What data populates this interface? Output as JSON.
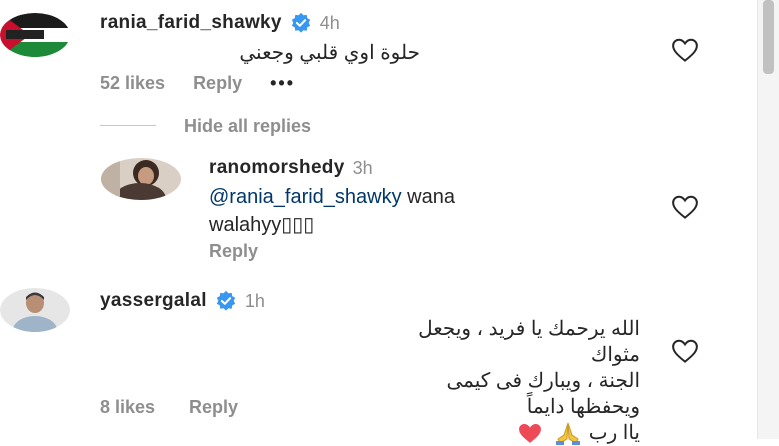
{
  "comments": [
    {
      "username": "rania_farid_shawky",
      "time": "4h",
      "text": "حلوة اوي قلبي وجعني",
      "likes": "52 likes",
      "reply_label": "Reply",
      "more_label": "•••"
    },
    {
      "username": "yassergalal",
      "time": "1h",
      "text_lines": [
        "الله يرحمك يا فريد ، ويجعل مثواك",
        "الجنة ، ويبارك فى كيمى ويحفظها دايماً",
        "ياا رب"
      ],
      "likes": "8 likes",
      "reply_label": "Reply"
    }
  ],
  "hide_replies_label": "Hide all replies",
  "reply": {
    "username": "ranomorshedy",
    "time": "3h",
    "mention": "@rania_farid_shawky",
    "text_after_mention": " wana",
    "text_line2": "walahyy▯▯▯",
    "reply_label": "Reply"
  },
  "colors": {
    "verified": "#3897f0",
    "heart_red": "#ed4956",
    "mention": "#00376b",
    "muted": "#8e8e8e"
  },
  "icons": [
    "verified-badge-icon",
    "heart-outline-icon",
    "red-heart-emoji",
    "folded-hands-emoji",
    "more-dots-icon"
  ]
}
